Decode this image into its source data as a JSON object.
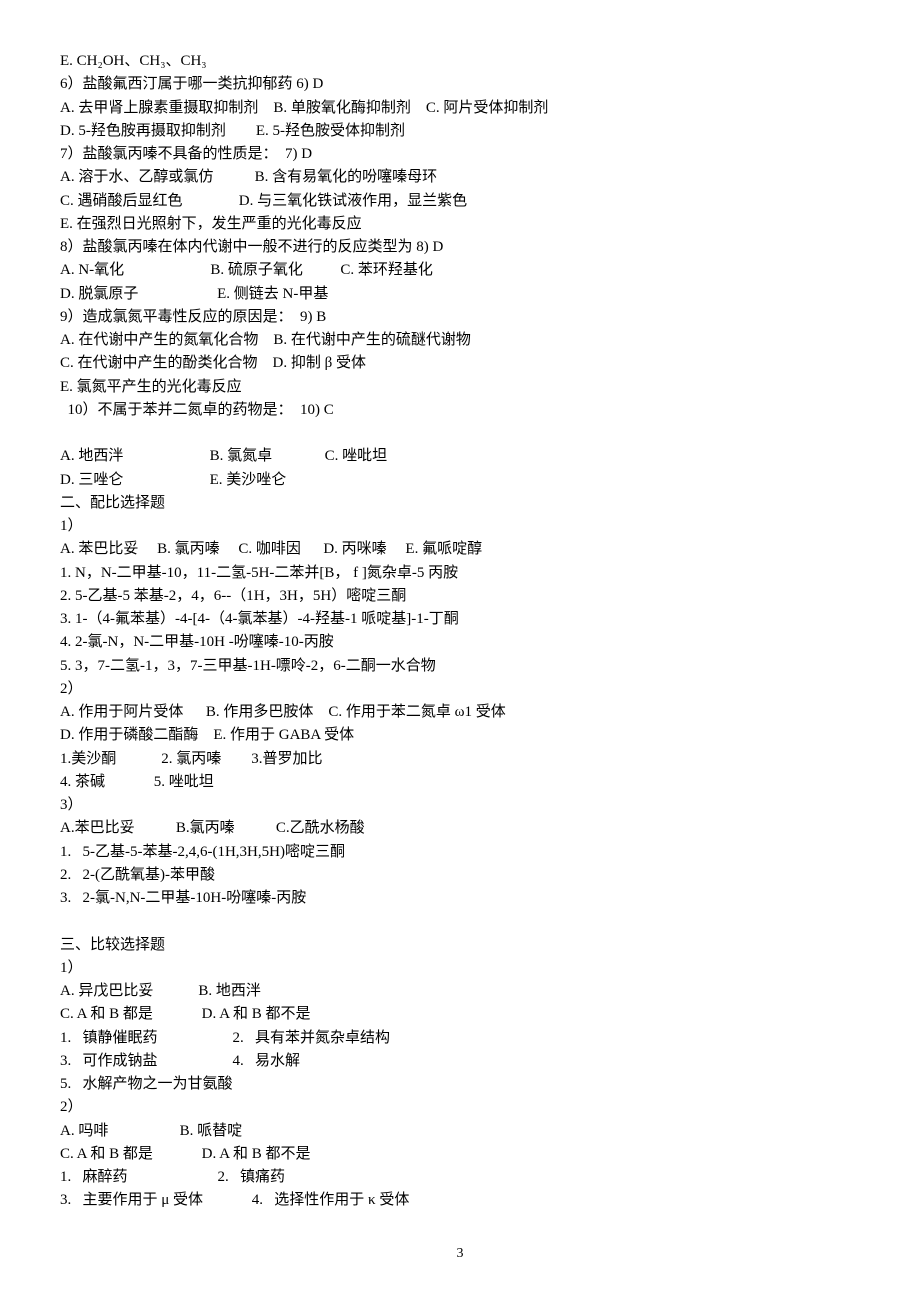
{
  "lines": [
    {
      "t": "E. CH₂OH、CH₃、CH₃"
    },
    {
      "t": "6）盐酸氟西汀属于哪一类抗抑郁药 6) D"
    },
    {
      "t": "A. 去甲肾上腺素重摄取抑制剂    B. 单胺氧化酶抑制剂    C. 阿片受体抑制剂"
    },
    {
      "t": "D. 5-羟色胺再摄取抑制剂        E. 5-羟色胺受体抑制剂"
    },
    {
      "t": "7）盐酸氯丙嗪不具备的性质是：  7) D"
    },
    {
      "t": "A. 溶于水、乙醇或氯仿           B. 含有易氧化的吩噻嗪母环"
    },
    {
      "t": "C. 遇硝酸后显红色               D. 与三氧化铁试液作用，显兰紫色"
    },
    {
      "t": "E. 在强烈日光照射下，发生严重的光化毒反应"
    },
    {
      "t": "8）盐酸氯丙嗪在体内代谢中一般不进行的反应类型为 8) D"
    },
    {
      "t": "A. N-氧化                       B. 硫原子氧化          C. 苯环羟基化"
    },
    {
      "t": "D. 脱氯原子                     E. 侧链去 N-甲基"
    },
    {
      "t": "9）造成氯氮平毒性反应的原因是：  9) B"
    },
    {
      "t": "A. 在代谢中产生的氮氧化合物    B. 在代谢中产生的硫醚代谢物"
    },
    {
      "t": "C. 在代谢中产生的酚类化合物    D. 抑制 β 受体"
    },
    {
      "t": "E. 氯氮平产生的光化毒反应"
    },
    {
      "t": "  10）不属于苯并二氮卓的药物是：  10) C"
    },
    {
      "t": ""
    },
    {
      "t": "A. 地西泮                       B. 氯氮卓              C. 唑吡坦"
    },
    {
      "t": "D. 三唑仑                       E. 美沙唑仑"
    },
    {
      "t": "二、配比选择题"
    },
    {
      "t": "1）"
    },
    {
      "t": "A. 苯巴比妥     B. 氯丙嗪     C. 咖啡因      D. 丙咪嗪     E. 氟哌啶醇"
    },
    {
      "t": "1. N，N-二甲基-10，11-二氢-5H-二苯并[B， f ]氮杂卓-5 丙胺"
    },
    {
      "t": "2. 5-乙基-5 苯基-2，4，6--（1H，3H，5H）嘧啶三酮"
    },
    {
      "t": "3. 1-（4-氟苯基）-4-[4-（4-氯苯基）-4-羟基-1 哌啶基]-1-丁酮"
    },
    {
      "t": "4. 2-氯-N，N-二甲基-10H -吩噻嗪-10-丙胺"
    },
    {
      "t": "5. 3，7-二氢-1，3，7-三甲基-1H-嘌呤-2，6-二酮一水合物"
    },
    {
      "t": "2）"
    },
    {
      "t": "A. 作用于阿片受体      B. 作用多巴胺体    C. 作用于苯二氮卓 ω1 受体"
    },
    {
      "t": "D. 作用于磷酸二酯酶    E. 作用于 GABA 受体"
    },
    {
      "t": "1.美沙酮            2. 氯丙嗪        3.普罗加比"
    },
    {
      "t": "4. 茶碱             5. 唑吡坦"
    },
    {
      "t": "3）"
    },
    {
      "t": "A.苯巴比妥           B.氯丙嗪           C.乙酰水杨酸"
    },
    {
      "t": "1.   5-乙基-5-苯基-2,4,6-(1H,3H,5H)嘧啶三酮"
    },
    {
      "t": "2.   2-(乙酰氧基)-苯甲酸"
    },
    {
      "t": "3.   2-氯-N,N-二甲基-10H-吩噻嗪-丙胺"
    },
    {
      "t": ""
    },
    {
      "t": "三、比较选择题"
    },
    {
      "t": "1）"
    },
    {
      "t": "A. 异戊巴比妥            B. 地西泮"
    },
    {
      "t": "C. A 和 B 都是             D. A 和 B 都不是"
    },
    {
      "t": "1.   镇静催眠药                    2.   具有苯并氮杂卓结构"
    },
    {
      "t": "3.   可作成钠盐                    4.   易水解"
    },
    {
      "t": "5.   水解产物之一为甘氨酸"
    },
    {
      "t": "2）"
    },
    {
      "t": "A. 吗啡                   B. 哌替啶"
    },
    {
      "t": "C. A 和 B 都是             D. A 和 B 都不是"
    },
    {
      "t": "1.   麻醉药                        2.   镇痛药"
    },
    {
      "t": "3.   主要作用于 μ 受体             4.   选择性作用于 κ 受体"
    }
  ],
  "page_number": "3"
}
